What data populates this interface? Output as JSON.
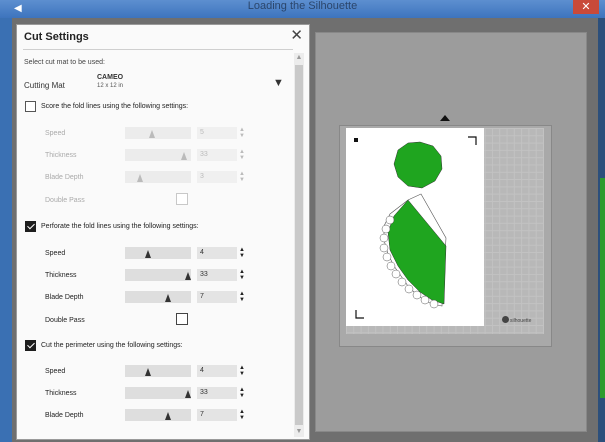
{
  "window": {
    "title": "Loading the Silhouette",
    "close_glyph": "✕"
  },
  "panel": {
    "title": "Cut Settings",
    "close_glyph": "✕",
    "select_label": "Select cut mat to be used:",
    "mat_label": "Cutting Mat",
    "mat_name": "CAMEO",
    "mat_size": "12 x 12 in",
    "dropdown_glyph": "▼"
  },
  "sections": [
    {
      "label": "Score the fold lines using the following settings:",
      "checked": false,
      "speed": "5",
      "thickness": "33",
      "blade_depth": "3",
      "double_pass": false
    },
    {
      "label": "Perforate the fold lines using the following settings:",
      "checked": true,
      "speed": "4",
      "thickness": "33",
      "blade_depth": "7",
      "double_pass": false
    },
    {
      "label": "Cut the perimeter using the following settings:",
      "checked": true,
      "speed": "4",
      "thickness": "33",
      "blade_depth": "7"
    }
  ],
  "row_labels": {
    "speed": "Speed",
    "thickness": "Thickness",
    "blade_depth": "Blade Depth",
    "double_pass": "Double Pass"
  },
  "spin_glyph": "▲▼",
  "preview": {
    "brand": "silhouette",
    "shape_color": "#1fa51f"
  }
}
